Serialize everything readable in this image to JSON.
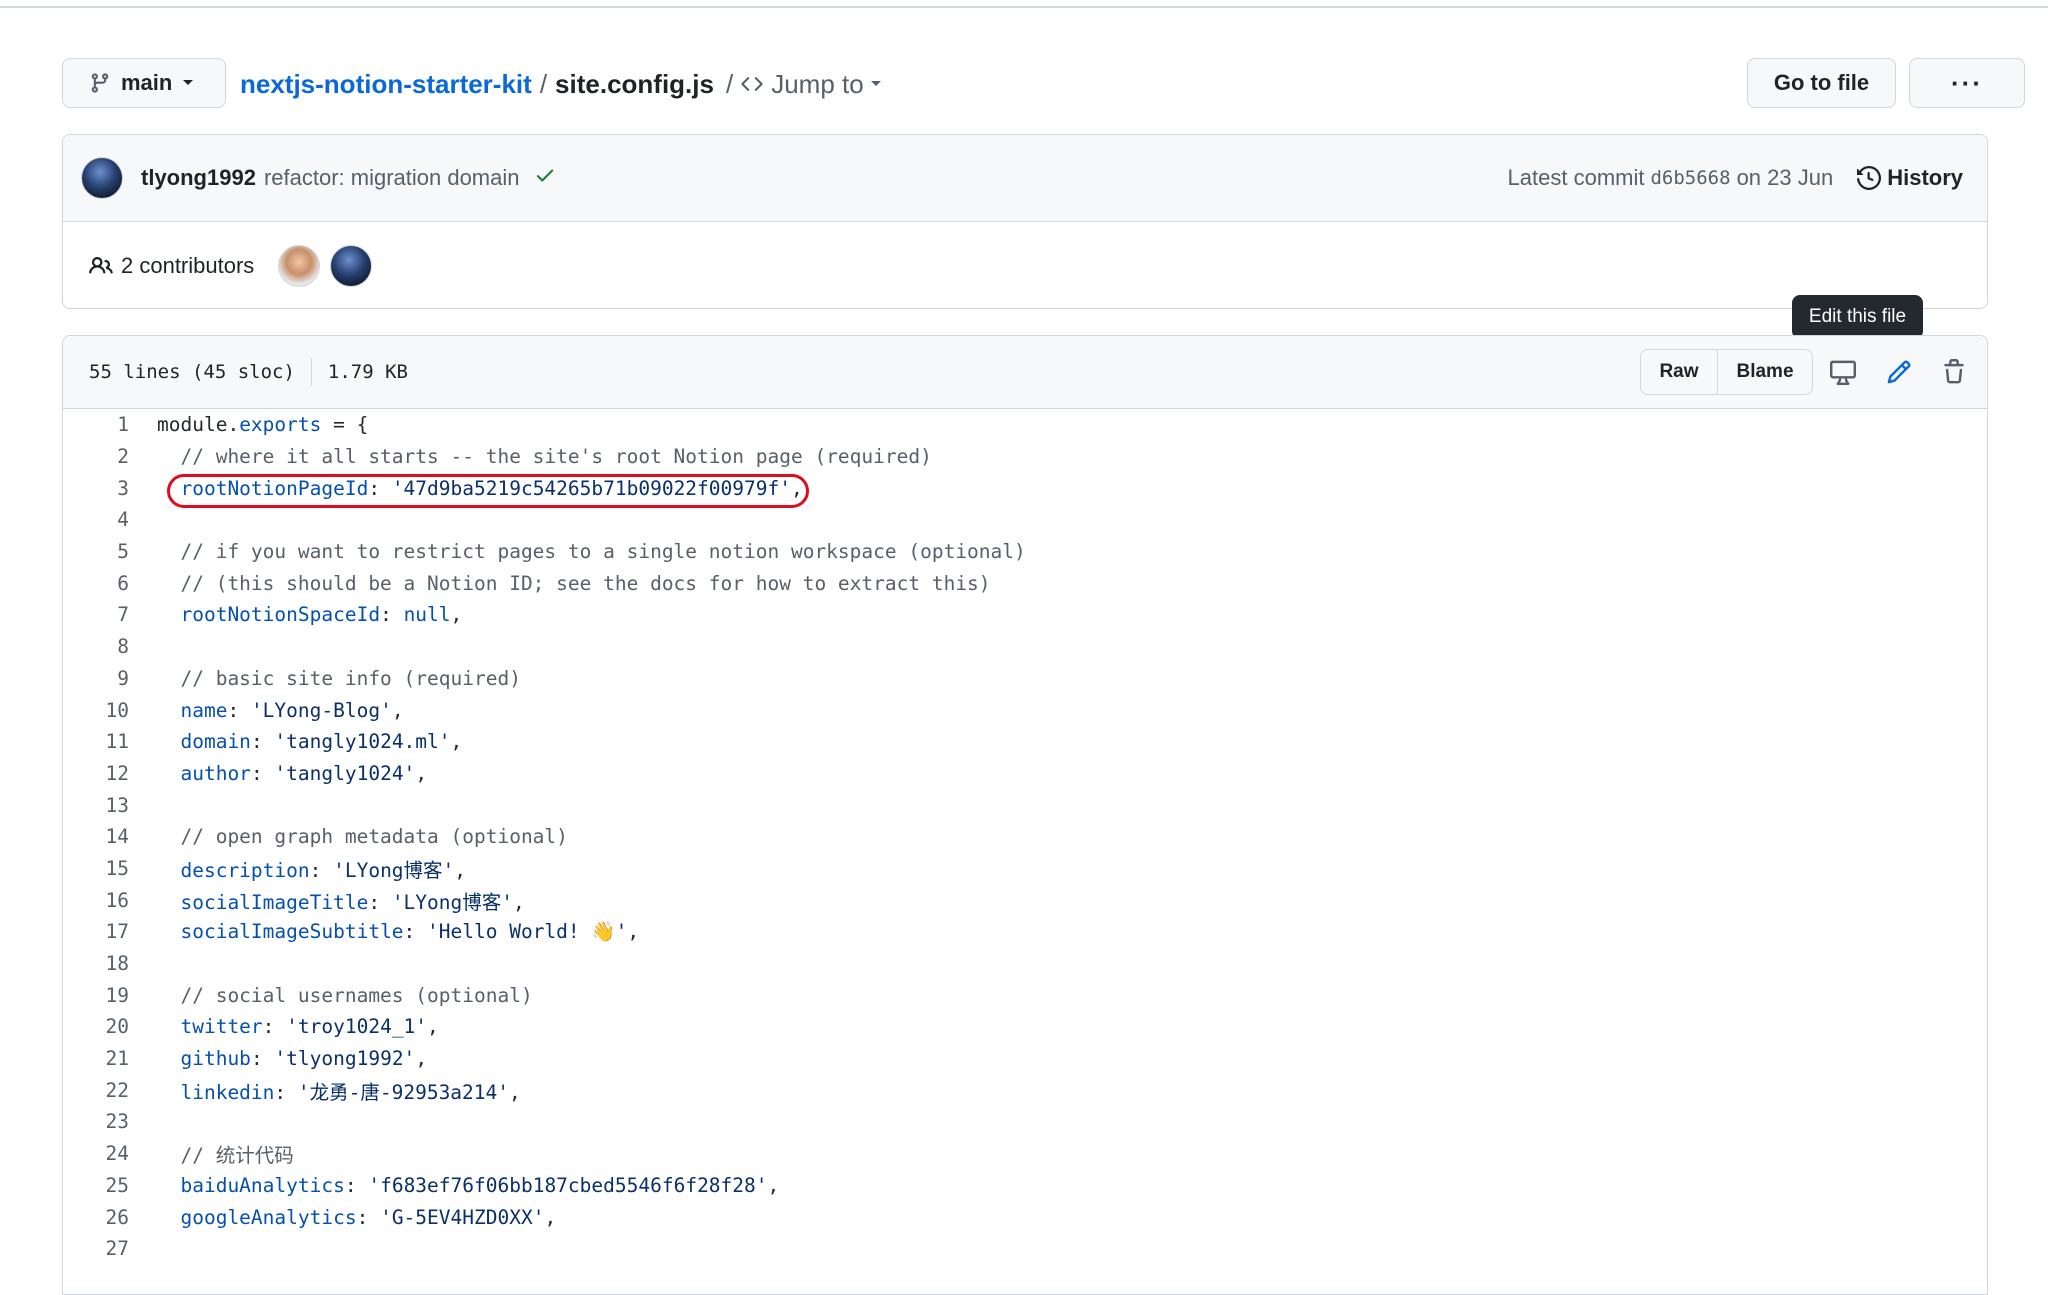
{
  "path_bar": {
    "branch": "main",
    "repo": "nextjs-notion-starter-kit",
    "separator": "/",
    "file": "site.config.js",
    "separator2": "/",
    "jump_to": "Jump to",
    "go_to_file": "Go to file",
    "more": "···"
  },
  "commit": {
    "author": "tlyong1992",
    "message": "refactor: migration domain",
    "latest_label": "Latest commit",
    "sha": "d6b5668",
    "date": "on 23 Jun",
    "history": "History"
  },
  "contributors": {
    "label": "2 contributors"
  },
  "file_header": {
    "lines": "55 lines (45 sloc)",
    "size": "1.79 KB",
    "raw": "Raw",
    "blame": "Blame"
  },
  "tooltip": "Edit this file",
  "code_lines": [
    {
      "n": "1",
      "parts": [
        [
          "plain",
          "module."
        ],
        [
          "prop",
          "exports"
        ],
        [
          "plain",
          " = {"
        ]
      ]
    },
    {
      "n": "2",
      "parts": [
        [
          "comment",
          "  // where it all starts -- the site's root Notion page (required)"
        ]
      ]
    },
    {
      "n": "3",
      "parts": [
        [
          "plain",
          "  "
        ],
        [
          "prop",
          "rootNotionPageId"
        ],
        [
          "plain",
          ": "
        ],
        [
          "str",
          "'47d9ba5219c54265b71b09022f00979f'"
        ],
        [
          "plain",
          ","
        ]
      ]
    },
    {
      "n": "4",
      "parts": []
    },
    {
      "n": "5",
      "parts": [
        [
          "comment",
          "  // if you want to restrict pages to a single notion workspace (optional)"
        ]
      ]
    },
    {
      "n": "6",
      "parts": [
        [
          "comment",
          "  // (this should be a Notion ID; see the docs for how to extract this)"
        ]
      ]
    },
    {
      "n": "7",
      "parts": [
        [
          "plain",
          "  "
        ],
        [
          "prop",
          "rootNotionSpaceId"
        ],
        [
          "plain",
          ": "
        ],
        [
          "null",
          "null"
        ],
        [
          "plain",
          ","
        ]
      ]
    },
    {
      "n": "8",
      "parts": []
    },
    {
      "n": "9",
      "parts": [
        [
          "comment",
          "  // basic site info (required)"
        ]
      ]
    },
    {
      "n": "10",
      "parts": [
        [
          "plain",
          "  "
        ],
        [
          "prop",
          "name"
        ],
        [
          "plain",
          ": "
        ],
        [
          "str",
          "'LYong-Blog'"
        ],
        [
          "plain",
          ","
        ]
      ]
    },
    {
      "n": "11",
      "parts": [
        [
          "plain",
          "  "
        ],
        [
          "prop",
          "domain"
        ],
        [
          "plain",
          ": "
        ],
        [
          "str",
          "'tangly1024.ml'"
        ],
        [
          "plain",
          ","
        ]
      ]
    },
    {
      "n": "12",
      "parts": [
        [
          "plain",
          "  "
        ],
        [
          "prop",
          "author"
        ],
        [
          "plain",
          ": "
        ],
        [
          "str",
          "'tangly1024'"
        ],
        [
          "plain",
          ","
        ]
      ]
    },
    {
      "n": "13",
      "parts": []
    },
    {
      "n": "14",
      "parts": [
        [
          "comment",
          "  // open graph metadata (optional)"
        ]
      ]
    },
    {
      "n": "15",
      "parts": [
        [
          "plain",
          "  "
        ],
        [
          "prop",
          "description"
        ],
        [
          "plain",
          ": "
        ],
        [
          "str",
          "'LYong博客'"
        ],
        [
          "plain",
          ","
        ]
      ]
    },
    {
      "n": "16",
      "parts": [
        [
          "plain",
          "  "
        ],
        [
          "prop",
          "socialImageTitle"
        ],
        [
          "plain",
          ": "
        ],
        [
          "str",
          "'LYong博客'"
        ],
        [
          "plain",
          ","
        ]
      ]
    },
    {
      "n": "17",
      "parts": [
        [
          "plain",
          "  "
        ],
        [
          "prop",
          "socialImageSubtitle"
        ],
        [
          "plain",
          ": "
        ],
        [
          "str",
          "'Hello World! 👋'"
        ],
        [
          "plain",
          ","
        ]
      ]
    },
    {
      "n": "18",
      "parts": []
    },
    {
      "n": "19",
      "parts": [
        [
          "comment",
          "  // social usernames (optional)"
        ]
      ]
    },
    {
      "n": "20",
      "parts": [
        [
          "plain",
          "  "
        ],
        [
          "prop",
          "twitter"
        ],
        [
          "plain",
          ": "
        ],
        [
          "str",
          "'troy1024_1'"
        ],
        [
          "plain",
          ","
        ]
      ]
    },
    {
      "n": "21",
      "parts": [
        [
          "plain",
          "  "
        ],
        [
          "prop",
          "github"
        ],
        [
          "plain",
          ": "
        ],
        [
          "str",
          "'tlyong1992'"
        ],
        [
          "plain",
          ","
        ]
      ]
    },
    {
      "n": "22",
      "parts": [
        [
          "plain",
          "  "
        ],
        [
          "prop",
          "linkedin"
        ],
        [
          "plain",
          ": "
        ],
        [
          "str",
          "'龙勇-唐-92953a214'"
        ],
        [
          "plain",
          ","
        ]
      ]
    },
    {
      "n": "23",
      "parts": []
    },
    {
      "n": "24",
      "parts": [
        [
          "comment",
          "  // 统计代码"
        ]
      ]
    },
    {
      "n": "25",
      "parts": [
        [
          "plain",
          "  "
        ],
        [
          "prop",
          "baiduAnalytics"
        ],
        [
          "plain",
          ": "
        ],
        [
          "str",
          "'f683ef76f06bb187cbed5546f6f28f28'"
        ],
        [
          "plain",
          ","
        ]
      ]
    },
    {
      "n": "26",
      "parts": [
        [
          "plain",
          "  "
        ],
        [
          "prop",
          "googleAnalytics"
        ],
        [
          "plain",
          ": "
        ],
        [
          "str",
          "'G-5EV4HZD0XX'"
        ],
        [
          "plain",
          ","
        ]
      ]
    },
    {
      "n": "27",
      "parts": []
    }
  ],
  "colors": {
    "link": "#0969da",
    "success": "#1a7f37",
    "highlight_oval": "#e00b1c"
  },
  "icons": [
    "git-branch-icon",
    "chevron-down-icon",
    "code-icon",
    "check-icon",
    "history-icon",
    "people-icon",
    "desktop-icon",
    "pencil-icon",
    "trash-icon"
  ]
}
